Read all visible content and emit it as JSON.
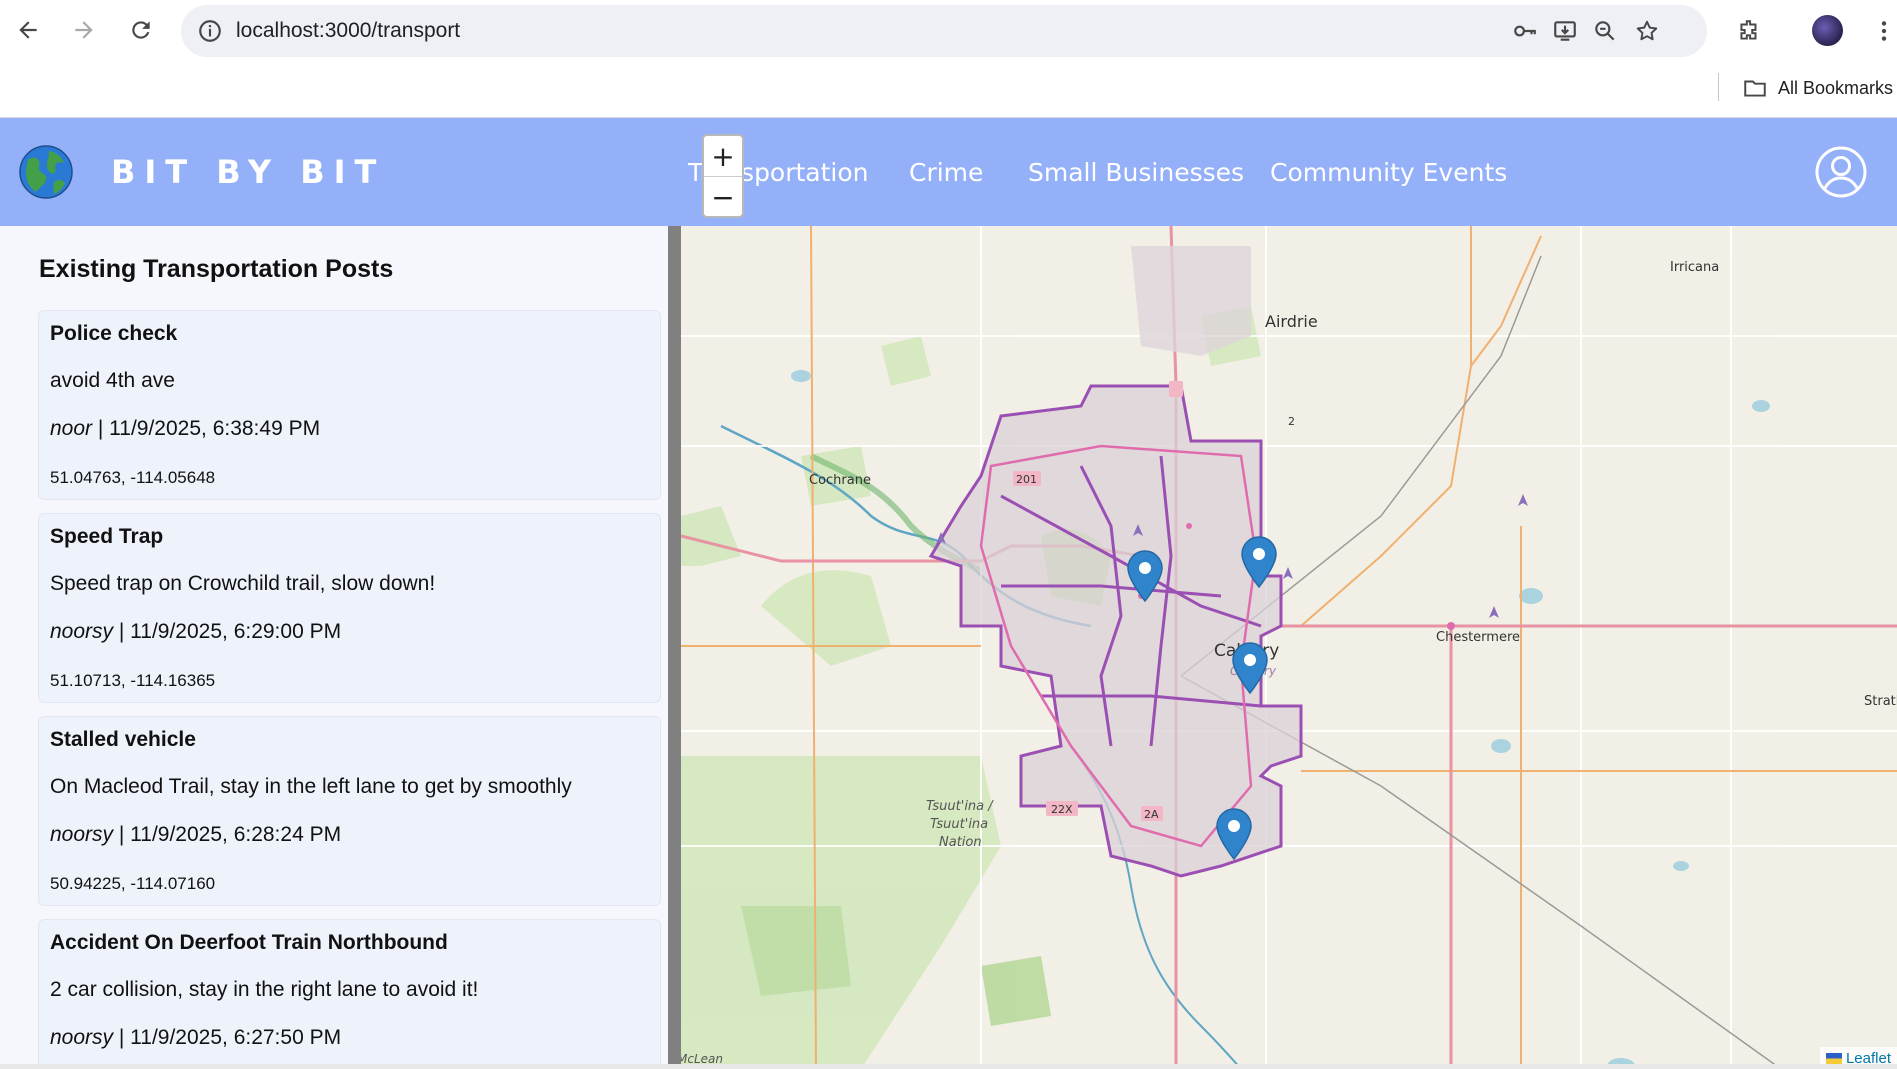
{
  "browser": {
    "url": "localhost:3000/transport",
    "bookmarks_label": "All Bookmarks"
  },
  "app": {
    "brand": "BIT BY BIT",
    "nav": [
      "Transportation",
      "Crime",
      "Small Businesses",
      "Community Events"
    ],
    "header_color": "#94b0f9"
  },
  "panel": {
    "title": "Existing Transportation Posts",
    "posts": [
      {
        "title": "Police check",
        "description": "avoid 4th ave",
        "author": "noor",
        "timestamp": "11/9/2025, 6:38:49 PM",
        "coords": "51.04763, -114.05648"
      },
      {
        "title": "Speed Trap",
        "description": "Speed trap on Crowchild trail, slow down!",
        "author": "noorsy",
        "timestamp": "11/9/2025, 6:29:00 PM",
        "coords": "51.10713, -114.16365"
      },
      {
        "title": "Stalled vehicle",
        "description": "On Macleod Trail, stay in the left lane to get by smoothly",
        "author": "noorsy",
        "timestamp": "11/9/2025, 6:28:24 PM",
        "coords": "50.94225, -114.07160"
      },
      {
        "title": "Accident On Deerfoot Train Northbound",
        "description": "2 car collision, stay in the right lane to avoid it!",
        "author": "noorsy",
        "timestamp": "11/9/2025, 6:27:50 PM",
        "coords": ""
      }
    ]
  },
  "map": {
    "zoom_in": "+",
    "zoom_out": "−",
    "attribution": "Leaflet",
    "marker_color": "#2f84cc",
    "labels": {
      "airdrie": "Airdrie",
      "cochrane": "Cochrane",
      "calgary": "Calgary",
      "calgary_sub": "Calgary",
      "chestermere": "Chestermere",
      "irricana": "Irricana",
      "strathmore": "Strath",
      "tsuutina_1": "Tsuut'ina /",
      "tsuutina_2": "Tsuut'ina",
      "tsuutina_3": "Nation",
      "mclean": "McLean",
      "hwy2": "2",
      "hwy201": "201",
      "hwy22x": "22X",
      "hwy2a": "2A"
    }
  }
}
